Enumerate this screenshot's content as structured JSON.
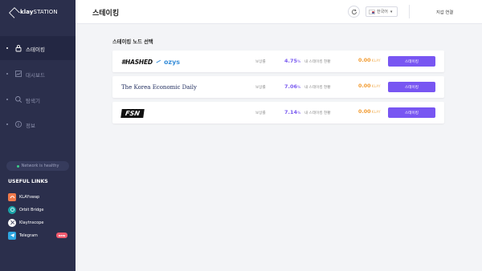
{
  "brand": {
    "name_bold": "klay",
    "name_light": "STATION"
  },
  "sidebar": {
    "items": [
      {
        "label": "스테이킹",
        "icon": "lock-icon",
        "active": true
      },
      {
        "label": "대시보드",
        "icon": "chart-icon",
        "active": false
      },
      {
        "label": "탐색기",
        "icon": "search-icon",
        "active": false
      },
      {
        "label": "정보",
        "icon": "info-icon",
        "active": false
      }
    ],
    "network_status": "Network is healthy",
    "useful_links_title": "USEFUL LINKS",
    "links": [
      {
        "label": "KLAYswap",
        "icon": "klayswap-icon",
        "color": "#f0794a"
      },
      {
        "label": "Orbit Bridge",
        "icon": "orbit-bridge-icon",
        "color": "#1aa5a9"
      },
      {
        "label": "Klaytnscope",
        "icon": "klaytnscope-icon",
        "color": "#2b2f4c"
      },
      {
        "label": "Telegram",
        "icon": "telegram-icon",
        "color": "#2ea6e0"
      }
    ],
    "new_badge": "new"
  },
  "header": {
    "title": "스테이킹",
    "language": "한국어",
    "connect_wallet": "지갑 연결"
  },
  "main": {
    "section_title": "스테이킹 노드 선택",
    "nodes": [
      {
        "logo_text_1": "#HASHED",
        "logo_text_2": "ozys",
        "reward_label": "보상률",
        "reward_value": "4.75",
        "reward_unit": "%",
        "my_staking_label": "내 스테이킹 현황",
        "my_staking_value": "0.00",
        "my_staking_unit": "KLAY",
        "button_label": "스테이킹"
      },
      {
        "logo_text_1": "The Korea Economic Daily",
        "reward_label": "보상률",
        "reward_value": "7.06",
        "reward_unit": "%",
        "my_staking_label": "내 스테이킹 현황",
        "my_staking_value": "0.00",
        "my_staking_unit": "KLAY",
        "button_label": "스테이킹"
      },
      {
        "logo_text_1": "FSN",
        "reward_label": "보상률",
        "reward_value": "7.14",
        "reward_unit": "%",
        "my_staking_label": "내 스테이킹 현황",
        "my_staking_value": "0.00",
        "my_staking_unit": "KLAY",
        "button_label": "스테이킹"
      }
    ]
  },
  "colors": {
    "sidebar_bg": "#2b2f4c",
    "accent_purple": "#7856f2",
    "reward_purple": "#7b5cf0",
    "staking_orange": "#f29a2e"
  }
}
